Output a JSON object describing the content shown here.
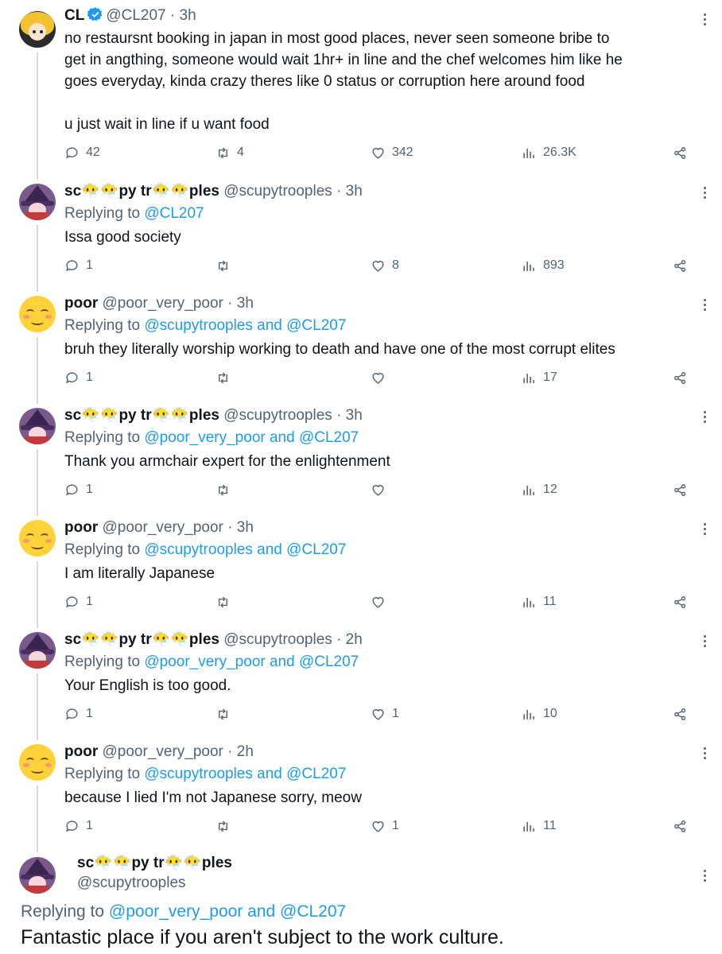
{
  "tweets": [
    {
      "name": "CL",
      "handle": "@CL207",
      "time": "· 3h",
      "verified": true,
      "text": "no restaursnt booking in japan in most good places, never seen someone bribe to\nget in angthing, someone would wait 1hr+ in line and the chef welcomes him like he\ngoes everyday, kinda crazy theres like 0 status or corruption here around food\n\nu just wait in line if u want food",
      "replies": "42",
      "retweets": "4",
      "likes": "342",
      "views": "26.3K"
    },
    {
      "name": "sc😶‍🌫️😶‍🌫️py tr😶‍🌫️😶‍🌫️ples",
      "handle": "@scupytrooples",
      "time": "· 3h",
      "reply_prefix": "Replying to ",
      "reply_targets": "@CL207",
      "text": "Issa good society",
      "replies": "1",
      "retweets": "",
      "likes": "8",
      "views": "893"
    },
    {
      "name": "poor",
      "handle": "@poor_very_poor",
      "time": "· 3h",
      "reply_prefix": "Replying to ",
      "reply_targets": "@scupytrooples and @CL207",
      "text": "bruh they literally worship working to death and have one of the most corrupt elites",
      "replies": "1",
      "retweets": "",
      "likes": "",
      "views": "17"
    },
    {
      "name": "sc😶‍🌫️😶‍🌫️py tr😶‍🌫️😶‍🌫️ples",
      "handle": "@scupytrooples",
      "time": "· 3h",
      "reply_prefix": "Replying to ",
      "reply_targets": "@poor_very_poor and @CL207",
      "text": "Thank you armchair expert for the enlightenment",
      "replies": "1",
      "retweets": "",
      "likes": "",
      "views": "12"
    },
    {
      "name": "poor",
      "handle": "@poor_very_poor",
      "time": "· 3h",
      "reply_prefix": "Replying to ",
      "reply_targets": "@scupytrooples and @CL207",
      "text": "I am literally Japanese",
      "replies": "1",
      "retweets": "",
      "likes": "",
      "views": "11"
    },
    {
      "name": "sc😶‍🌫️😶‍🌫️py tr😶‍🌫️😶‍🌫️ples",
      "handle": "@scupytrooples",
      "time": "· 2h",
      "reply_prefix": "Replying to ",
      "reply_targets": "@poor_very_poor and @CL207",
      "text": "Your English is too good.",
      "replies": "1",
      "retweets": "",
      "likes": "1",
      "views": "10"
    },
    {
      "name": "poor",
      "handle": "@poor_very_poor",
      "time": "· 2h",
      "reply_prefix": "Replying to ",
      "reply_targets": "@scupytrooples and @CL207",
      "text": "because I lied I'm not Japanese sorry, meow",
      "replies": "1",
      "retweets": "",
      "likes": "1",
      "views": "11"
    }
  ],
  "focused": {
    "name": "sc😶‍🌫️😶‍🌫️py tr😶‍🌫️😶‍🌫️ples",
    "handle": "@scupytrooples",
    "reply_prefix": "Replying to ",
    "reply_targets": "@poor_very_poor and @CL207",
    "text": "Fantastic place if you aren't subject to the work culture."
  },
  "colors": {
    "link": "#1d9bf0",
    "muted": "#536471",
    "verified": "#1d9bf0",
    "thread_line": "#cfd9de"
  }
}
